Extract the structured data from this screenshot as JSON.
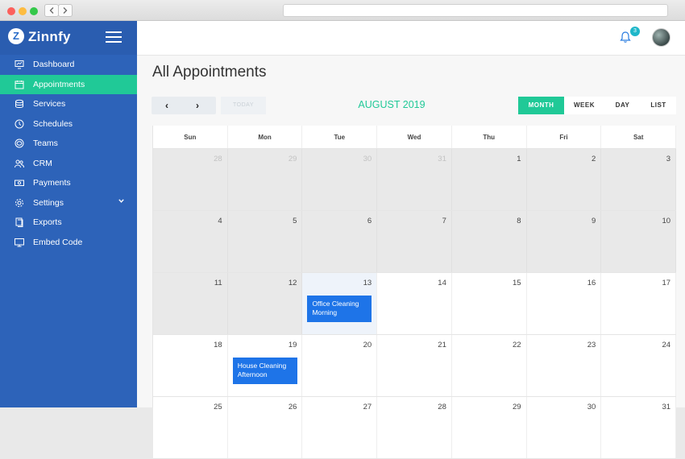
{
  "app": {
    "brand_letter": "Z",
    "brand_name": "Zinnfy"
  },
  "sidebar": {
    "items": [
      {
        "label": "Dashboard",
        "icon": "dashboard-icon"
      },
      {
        "label": "Appointments",
        "icon": "appointments-icon",
        "active": true
      },
      {
        "label": "Services",
        "icon": "services-icon"
      },
      {
        "label": "Schedules",
        "icon": "schedules-icon"
      },
      {
        "label": "Teams",
        "icon": "teams-icon"
      },
      {
        "label": "CRM",
        "icon": "crm-icon"
      },
      {
        "label": "Payments",
        "icon": "payments-icon"
      },
      {
        "label": "Settings",
        "icon": "settings-icon",
        "has_submenu": true
      },
      {
        "label": "Exports",
        "icon": "exports-icon"
      },
      {
        "label": "Embed Code",
        "icon": "embed-code-icon"
      }
    ]
  },
  "topbar": {
    "notification_count": "3"
  },
  "page": {
    "title": "All Appointments"
  },
  "toolbar": {
    "prev_label": "‹",
    "next_label": "›",
    "today_label": "TODAY",
    "month_title": "AUGUST 2019",
    "views": [
      "MONTH",
      "WEEK",
      "DAY",
      "LIST"
    ],
    "active_view": "MONTH"
  },
  "calendar": {
    "days_of_week": [
      "Sun",
      "Mon",
      "Tue",
      "Wed",
      "Thu",
      "Fri",
      "Sat"
    ],
    "weeks": [
      [
        28,
        29,
        30,
        31,
        1,
        2,
        3
      ],
      [
        4,
        5,
        6,
        7,
        8,
        9,
        10
      ],
      [
        11,
        12,
        13,
        14,
        15,
        16,
        17
      ],
      [
        18,
        19,
        20,
        21,
        22,
        23,
        24
      ],
      [
        25,
        26,
        27,
        28,
        29,
        30,
        31
      ]
    ],
    "events": [
      {
        "day": 13,
        "title": "Office Cleaning Morning"
      },
      {
        "day": 19,
        "title": "House Cleaning Afternoon"
      }
    ]
  },
  "colors": {
    "sidebar": "#2d63b9",
    "accent": "#20c997",
    "event": "#1e74e8",
    "badge": "#1fb7c9"
  }
}
